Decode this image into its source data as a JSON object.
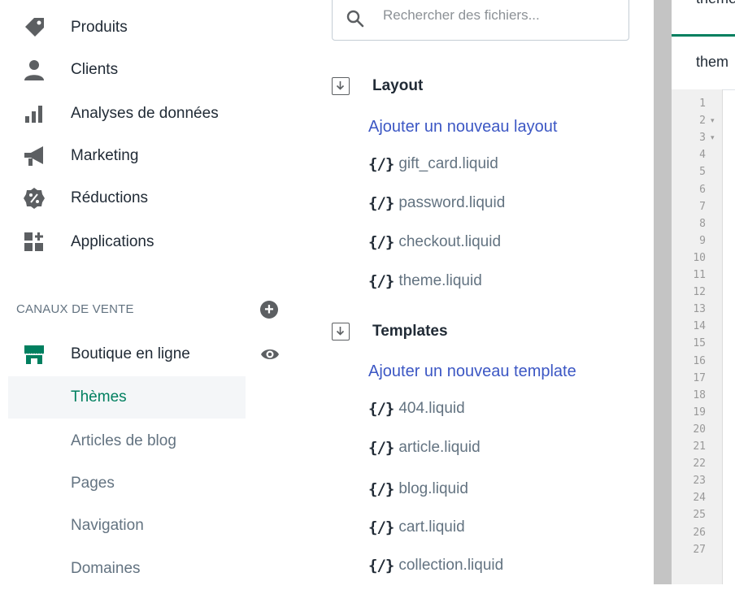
{
  "sidebar": {
    "items": [
      {
        "label": "Produits",
        "icon": "tag-icon"
      },
      {
        "label": "Clients",
        "icon": "person-icon"
      },
      {
        "label": "Analyses de données",
        "icon": "bar-chart-icon"
      },
      {
        "label": "Marketing",
        "icon": "megaphone-icon"
      },
      {
        "label": "Réductions",
        "icon": "discount-icon"
      },
      {
        "label": "Applications",
        "icon": "apps-icon"
      }
    ],
    "channels_heading": "CANAUX DE VENTE",
    "store_label": "Boutique en ligne",
    "sub_items": [
      "Thèmes",
      "Articles de blog",
      "Pages",
      "Navigation",
      "Domaines"
    ],
    "active_sub": "Thèmes"
  },
  "files": {
    "search_placeholder": "Rechercher des fichiers...",
    "icon_glyph": "{/}",
    "layout": {
      "title": "Layout",
      "add_link": "Ajouter un nouveau layout",
      "files": [
        "gift_card.liquid",
        "password.liquid",
        "checkout.liquid",
        "theme.liquid"
      ]
    },
    "templates": {
      "title": "Templates",
      "add_link": "Ajouter un nouveau template",
      "files": [
        "404.liquid",
        "article.liquid",
        "blog.liquid",
        "cart.liquid",
        "collection.liquid"
      ]
    }
  },
  "editor": {
    "tab_label": "theme",
    "open_file_label": "them",
    "line_numbers": [
      "1",
      "2",
      "3",
      "4",
      "5",
      "6",
      "7",
      "8",
      "9",
      "10",
      "11",
      "12",
      "13",
      "14",
      "15",
      "16",
      "17",
      "18",
      "19",
      "20",
      "21",
      "22",
      "23",
      "24",
      "25",
      "26",
      "27"
    ],
    "folded_lines": [
      "2",
      "3"
    ]
  },
  "colors": {
    "accent_green": "#007f5f",
    "link_blue": "#3c57c4",
    "text_dark": "#212b36",
    "text_muted": "#637381"
  }
}
